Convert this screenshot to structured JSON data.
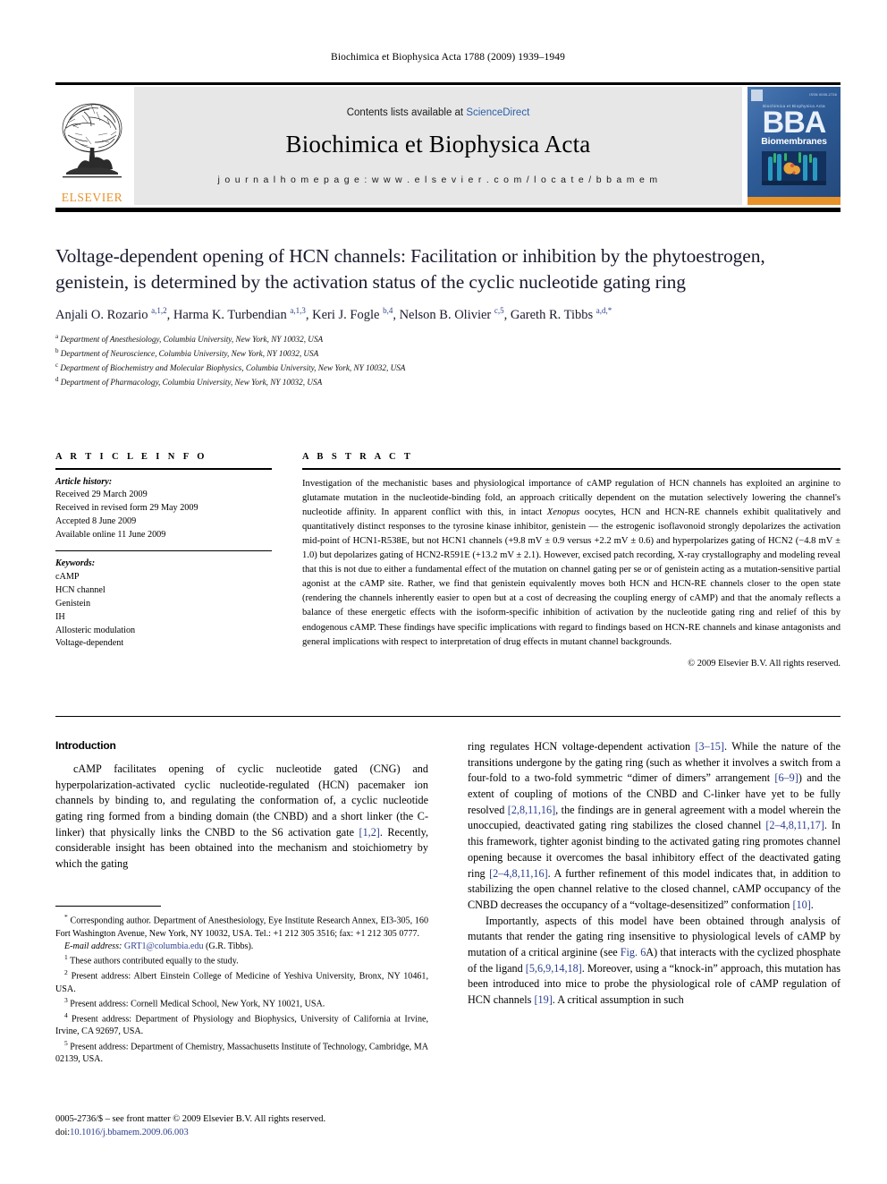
{
  "running_head": "Biochimica et Biophysica Acta 1788 (2009) 1939–1949",
  "masthead": {
    "contents_prefix": "Contents lists available at ",
    "sciencedirect": "ScienceDirect",
    "journal_title": "Biochimica et Biophysica Acta",
    "homepage": "j o u r n a l   h o m e p a g e :   w w w . e l s e v i e r . c o m / l o c a t e / b b a m e m",
    "elsevier_wordmark": "ELSEVIER",
    "cover": {
      "big_text": "BBA",
      "sub_text": "Biomembranes",
      "small_title": "Biochimica et Biophysica Acta",
      "issn": "ISSN 0005-2736"
    },
    "accent_orange": "#E8922A",
    "link_blue": "#2b5faa"
  },
  "article": {
    "title": "Voltage-dependent opening of HCN channels: Facilitation or inhibition by the phytoestrogen, genistein, is determined by the activation status of the cyclic nucleotide gating ring",
    "authors_html": "Anjali O. Rozario <sup>a,1,2</sup>, Harma K. Turbendian <sup>a,1,3</sup>, Keri J. Fogle <sup>b,4</sup>, Nelson B. Olivier <sup>c,5</sup>, Gareth R. Tibbs <sup>a,d,*</sup>",
    "affiliations": [
      {
        "marker": "a",
        "text": "Department of Anesthesiology, Columbia University, New York, NY 10032, USA"
      },
      {
        "marker": "b",
        "text": "Department of Neuroscience, Columbia University, New York, NY 10032, USA"
      },
      {
        "marker": "c",
        "text": "Department of Biochemistry and Molecular Biophysics, Columbia University, New York, NY 10032, USA"
      },
      {
        "marker": "d",
        "text": "Department of Pharmacology, Columbia University, New York, NY 10032, USA"
      }
    ]
  },
  "article_info": {
    "heading": "A R T I C L E  I N F O",
    "history_label": "Article history:",
    "history": [
      "Received 29 March 2009",
      "Received in revised form 29 May 2009",
      "Accepted 8 June 2009",
      "Available online 11 June 2009"
    ],
    "keywords_label": "Keywords:",
    "keywords": [
      "cAMP",
      "HCN channel",
      "Genistein",
      "IH",
      "Allosteric modulation",
      "Voltage-dependent"
    ]
  },
  "abstract": {
    "heading": "A B S T R A C T",
    "text_html": "Investigation of the mechanistic bases and physiological importance of cAMP regulation of HCN channels has exploited an arginine to glutamate mutation in the nucleotide-binding fold, an approach critically dependent on the mutation selectively lowering the channel's nucleotide affinity. In apparent conflict with this, in intact <i>Xenopus</i> oocytes, HCN and HCN-RE channels exhibit qualitatively and quantitatively distinct responses to the tyrosine kinase inhibitor, genistein — the estrogenic isoflavonoid strongly depolarizes the activation mid-point of HCN1-R538E, but not HCN1 channels (+9.8 mV ± 0.9 versus +2.2 mV ± 0.6) and hyperpolarizes gating of HCN2 (−4.8 mV ± 1.0) but depolarizes gating of HCN2-R591E (+13.2 mV ± 2.1). However, excised patch recording, X-ray crystallography and modeling reveal that this is not due to either a fundamental effect of the mutation on channel gating per se or of genistein acting as a mutation-sensitive partial agonist at the cAMP site. Rather, we find that genistein equivalently moves both HCN and HCN-RE channels closer to the open state (rendering the channels inherently easier to open but at a cost of decreasing the coupling energy of cAMP) and that the anomaly reflects a balance of these energetic effects with the isoform-specific inhibition of activation by the nucleotide gating ring and relief of this by endogenous cAMP. These findings have specific implications with regard to findings based on HCN-RE channels and kinase antagonists and general implications with respect to interpretation of drug effects in mutant channel backgrounds.",
    "copyright": "© 2009 Elsevier B.V. All rights reserved."
  },
  "body": {
    "intro_heading": "Introduction",
    "left_para_html": "cAMP facilitates opening of cyclic nucleotide gated (CNG) and hyperpolarization-activated cyclic nucleotide-regulated (HCN) pacemaker ion channels by binding to, and regulating the conformation of, a cyclic nucleotide gating ring formed from a binding domain (the CNBD) and a short linker (the C-linker) that physically links the CNBD to the S6 activation gate <span class=\"ref\">[1,2]</span>. Recently, considerable insight has been obtained into the mechanism and stoichiometry by which the gating",
    "right_para1_html": "ring regulates HCN voltage-dependent activation <span class=\"ref\">[3–15]</span>. While the nature of the transitions undergone by the gating ring (such as whether it involves a switch from a four-fold to a two-fold symmetric “dimer of dimers” arrangement <span class=\"ref\">[6–9]</span>) and the extent of coupling of motions of the CNBD and C-linker have yet to be fully resolved <span class=\"ref\">[2,8,11,16]</span>, the findings are in general agreement with a model wherein the unoccupied, deactivated gating ring stabilizes the closed channel <span class=\"ref\">[2–4,8,11,17]</span>. In this framework, tighter agonist binding to the activated gating ring promotes channel opening because it overcomes the basal inhibitory effect of the deactivated gating ring <span class=\"ref\">[2–4,8,11,16]</span>. A further refinement of this model indicates that, in addition to stabilizing the open channel relative to the closed channel, cAMP occupancy of the CNBD decreases the occupancy of a “voltage-desensitized” conformation <span class=\"ref\">[10]</span>.",
    "right_para2_html": "Importantly, aspects of this model have been obtained through analysis of mutants that render the gating ring insensitive to physiological levels of cAMP by mutation of a critical arginine (see <span class=\"ref\">Fig. 6</span>A) that interacts with the cyclized phosphate of the ligand <span class=\"ref\">[5,6,9,14,18]</span>. Moreover, using a “knock-in” approach, this mutation has been introduced into mice to probe the physiological role of cAMP regulation of HCN channels <span class=\"ref\">[19]</span>. A critical assumption in such"
  },
  "footnotes": [
    {
      "marker": "*",
      "html": "<sup>*</sup> Corresponding author. Department of Anesthesiology, Eye Institute Research Annex, EI3-305, 160 Fort Washington Avenue, New York, NY 10032, USA. Tel.: +1 212 305 3516; fax: +1 212 305 0777."
    },
    {
      "marker": "email",
      "html": "<i>E-mail address:</i> <span class=\"email\">GRT1@columbia.edu</span> (G.R. Tibbs)."
    },
    {
      "marker": "1",
      "html": "<sup>1</sup> These authors contributed equally to the study."
    },
    {
      "marker": "2",
      "html": "<sup>2</sup> Present address: Albert Einstein College of Medicine of Yeshiva University, Bronx, NY 10461, USA."
    },
    {
      "marker": "3",
      "html": "<sup>3</sup> Present address: Cornell Medical School, New York, NY 10021, USA."
    },
    {
      "marker": "4",
      "html": "<sup>4</sup> Present address: Department of Physiology and Biophysics, University of California at Irvine, Irvine, CA 92697, USA."
    },
    {
      "marker": "5",
      "html": "<sup>5</sup> Present address: Department of Chemistry, Massachusetts Institute of Technology, Cambridge, MA 02139, USA."
    }
  ],
  "imprint": {
    "line1": "0005-2736/$ – see front matter © 2009 Elsevier B.V. All rights reserved.",
    "doi_label": "doi:",
    "doi_value": "10.1016/j.bbamem.2009.06.003"
  }
}
